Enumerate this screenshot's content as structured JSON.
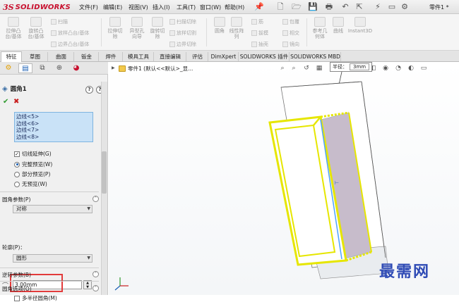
{
  "app": {
    "logo_ds": "3S",
    "logo_name": "SOLIDWORKS",
    "file_title": "零件1 *"
  },
  "menu": [
    "文件(F)",
    "编辑(E)",
    "视图(V)",
    "插入(I)",
    "工具(T)",
    "窗口(W)",
    "帮助(H)"
  ],
  "ribbon": {
    "big": [
      "拉伸凸\n台/基体",
      "旋转凸\n台/基体",
      "拉伸切\n除",
      "异型孔\n向导",
      "旋转切\n除",
      "圆角",
      "线性阵\n列",
      "参考几\n何体",
      "曲线",
      "Instant3D"
    ],
    "small": [
      "扫描",
      "放样凸台/基体",
      "边界凸台/基体",
      "扫描切除",
      "放样切割",
      "边界切除",
      "筋",
      "包覆",
      "拔模",
      "相交",
      "抽壳",
      "镜向"
    ]
  },
  "tabs": [
    "特征",
    "草图",
    "曲面",
    "钣金",
    "焊件",
    "模具工具",
    "直接编辑",
    "评估",
    "DimXpert",
    "SOLIDWORKS 插件",
    "SOLIDWORKS MBD"
  ],
  "panel": {
    "feature_title": "圆角1",
    "help": "?",
    "edges": [
      "边线<5>",
      "边线<6>",
      "边线<7>",
      "边线<8>"
    ],
    "tangent_propagation": "切线延伸(G)",
    "preview_full": "完整预览(W)",
    "preview_partial": "部分预览(P)",
    "preview_none": "无预览(W)",
    "fillet_params_title": "圆角参数(P)",
    "profile_type": "对称",
    "radius_value": "3.00mm",
    "multi_radius": "多半径圆角(M)",
    "contour_label": "轮廓(P)：",
    "contour_value": "圆形",
    "setback_title": "逆转参数(B)",
    "fillet_options_title": "圆角选项(O)"
  },
  "viewport": {
    "tree_label": "零件1 (默认<<默认>_显...",
    "callout_label": "半径：",
    "callout_value": "3mm",
    "watermark": "最需网"
  }
}
